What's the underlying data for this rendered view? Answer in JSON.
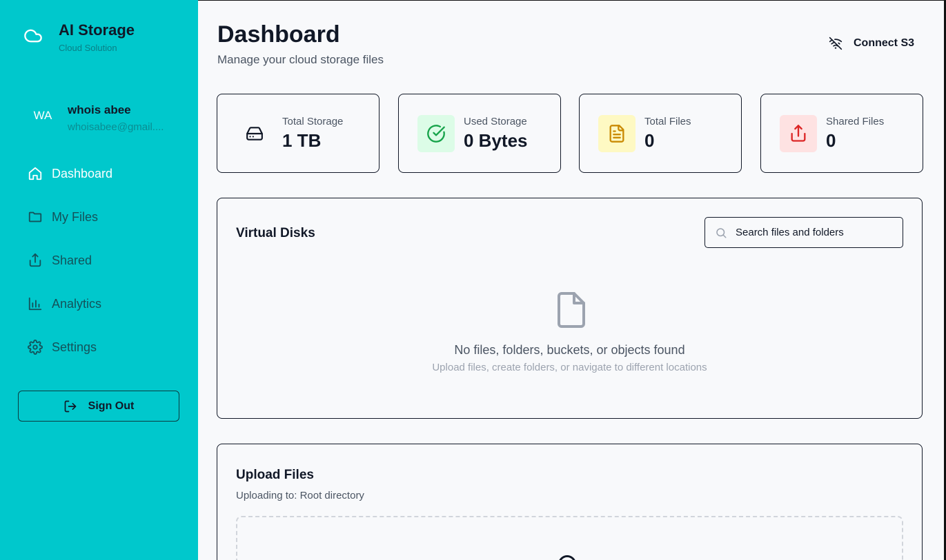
{
  "brand": {
    "title": "AI Storage",
    "subtitle": "Cloud Solution"
  },
  "user": {
    "initials": "WA",
    "name": "whois abee",
    "email": "whoisabee@gmail...."
  },
  "nav": {
    "items": [
      {
        "label": "Dashboard",
        "icon": "home-icon",
        "active": true
      },
      {
        "label": "My Files",
        "icon": "folder-icon",
        "active": false
      },
      {
        "label": "Shared",
        "icon": "share-icon",
        "active": false
      },
      {
        "label": "Analytics",
        "icon": "bar-chart-icon",
        "active": false
      },
      {
        "label": "Settings",
        "icon": "gear-icon",
        "active": false
      }
    ]
  },
  "signout": {
    "label": "Sign Out"
  },
  "header": {
    "title": "Dashboard",
    "subtitle": "Manage your cloud storage files",
    "connect_label": "Connect S3"
  },
  "stats": [
    {
      "label": "Total Storage",
      "value": "1 TB",
      "icon": "hard-drive-icon",
      "color": "#111827",
      "bg": "transparent"
    },
    {
      "label": "Used Storage",
      "value": "0 Bytes",
      "icon": "check-circle-icon",
      "color": "#16a34a",
      "bg": "#dcfce7"
    },
    {
      "label": "Total Files",
      "value": "0",
      "icon": "file-text-icon",
      "color": "#ca8a04",
      "bg": "#fef9c3"
    },
    {
      "label": "Shared Files",
      "value": "0",
      "icon": "upload-share-icon",
      "color": "#dc2626",
      "bg": "#fee2e2"
    }
  ],
  "virtual_disks": {
    "title": "Virtual Disks",
    "search_placeholder": "Search files and folders",
    "empty_title": "No files, folders, buckets, or objects found",
    "empty_subtitle": "Upload files, create folders, or navigate to different locations"
  },
  "upload": {
    "title": "Upload Files",
    "target": "Uploading to: Root directory"
  }
}
